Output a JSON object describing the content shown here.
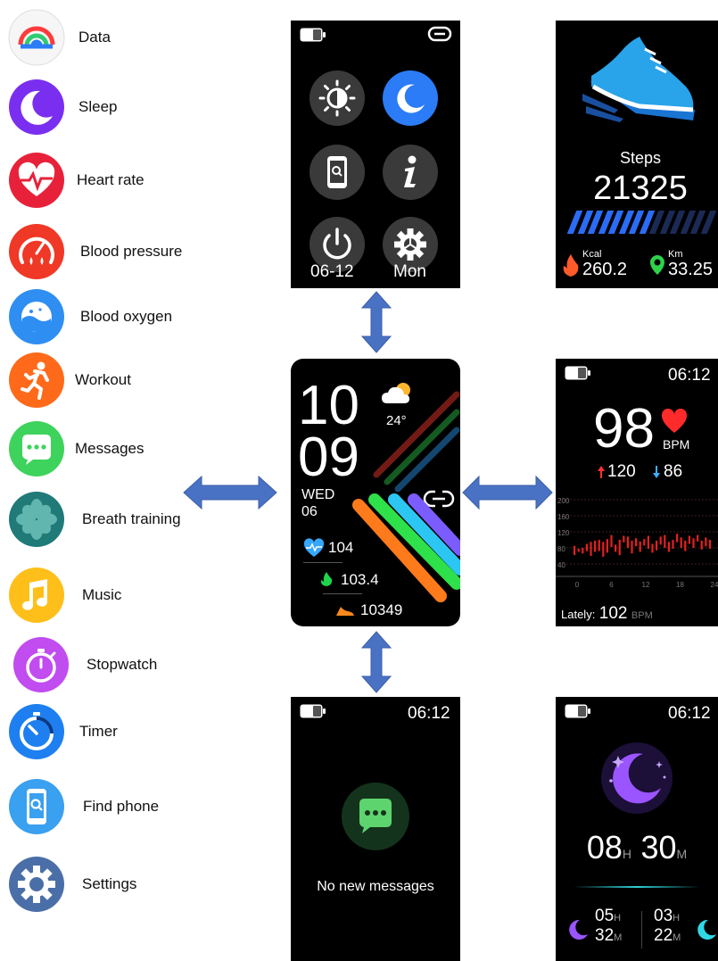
{
  "apps": [
    {
      "label": "Data",
      "icon": "data-icon"
    },
    {
      "label": "Sleep",
      "icon": "moon-icon"
    },
    {
      "label": "Heart rate",
      "icon": "heart-rate-icon"
    },
    {
      "label": "Blood pressure",
      "icon": "blood-pressure-icon"
    },
    {
      "label": "Blood oxygen",
      "icon": "blood-oxygen-icon"
    },
    {
      "label": "Workout",
      "icon": "runner-icon"
    },
    {
      "label": "Messages",
      "icon": "chat-icon"
    },
    {
      "label": "Breath training",
      "icon": "breath-flower-icon"
    },
    {
      "label": "Music",
      "icon": "music-note-icon"
    },
    {
      "label": "Stopwatch",
      "icon": "stopwatch-icon"
    },
    {
      "label": "Timer",
      "icon": "timer-icon"
    },
    {
      "label": "Find phone",
      "icon": "find-phone-icon"
    },
    {
      "label": "Settings",
      "icon": "gear-icon"
    }
  ],
  "quick_menu": {
    "date": "06-12",
    "day": "Mon",
    "buttons": [
      "brightness-icon",
      "do-not-disturb-moon-icon",
      "find-phone-icon",
      "info-icon",
      "power-icon",
      "settings-gear-icon"
    ]
  },
  "steps": {
    "label": "Steps",
    "value": "21325",
    "progress": 0.6,
    "kcal_label": "Kcal",
    "kcal_value": "260.2",
    "km_label": "Km",
    "km_value": "33.25"
  },
  "watchface": {
    "hour": "10",
    "minute": "09",
    "weekday": "WED",
    "day": "06",
    "temperature": "24°",
    "heart_rate": "104",
    "calories": "103.4",
    "steps": "10349"
  },
  "heart": {
    "time": "06:12",
    "bpm": "98",
    "unit": "BPM",
    "max": "120",
    "min": "86",
    "y_ticks": [
      "200",
      "160",
      "120",
      "80",
      "40"
    ],
    "x_ticks": [
      "0",
      "6",
      "12",
      "18",
      "24"
    ],
    "lately_label": "Lately:",
    "lately_value": "102",
    "lately_unit": "BPM"
  },
  "messages": {
    "time": "06:12",
    "empty_text": "No new messages"
  },
  "sleep": {
    "time": "06:12",
    "hours": "08",
    "hours_unit": "H",
    "minutes": "30",
    "minutes_unit": "M",
    "deep_h": "05",
    "deep_h_unit": "H",
    "deep_m": "32",
    "deep_m_unit": "M",
    "light_h": "03",
    "light_h_unit": "H",
    "light_m": "22",
    "light_m_unit": "M"
  },
  "colors": {
    "arrow": "#4a72c4",
    "accent_blue": "#2b7cf6",
    "heart_red": "#e02020",
    "sleep_purple": "#8a3dff"
  }
}
